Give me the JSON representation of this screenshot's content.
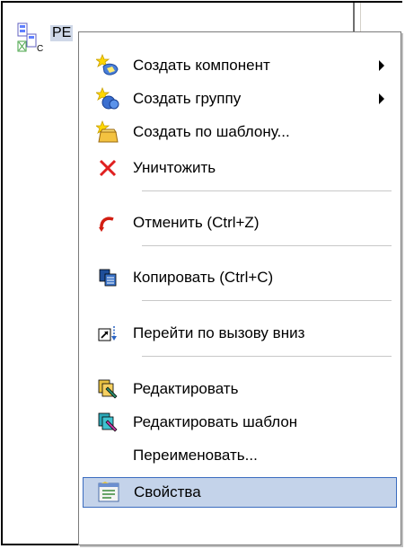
{
  "tree": {
    "node_label": "PE"
  },
  "menu": {
    "items": [
      {
        "label": "Создать компонент",
        "icon": "star-component-icon",
        "submenu": true
      },
      {
        "label": "Создать группу",
        "icon": "star-group-icon",
        "submenu": true
      },
      {
        "label": "Создать по шаблону...",
        "icon": "star-template-icon",
        "submenu": false
      },
      {
        "label": "Уничтожить",
        "icon": "red-x-delete-icon",
        "submenu": false
      },
      {
        "label": "Отменить (Ctrl+Z)",
        "icon": "undo-arrow-icon",
        "submenu": false
      },
      {
        "label": "Копировать (Ctrl+C)",
        "icon": "copy-icon",
        "submenu": false
      },
      {
        "label": "Перейти по вызову вниз",
        "icon": "goto-call-down-icon",
        "submenu": false
      },
      {
        "label": "Редактировать",
        "icon": "edit-icon",
        "submenu": false
      },
      {
        "label": "Редактировать шаблон",
        "icon": "edit-template-icon",
        "submenu": false
      },
      {
        "label": "Переименовать...",
        "icon": "",
        "submenu": false
      },
      {
        "label": "Свойства",
        "icon": "properties-icon",
        "submenu": false,
        "highlighted": true
      }
    ]
  },
  "colors": {
    "highlight_bg": "#c4d3ea",
    "highlight_border": "#3a6cbf",
    "delete_red": "#e02020",
    "undo_red": "#d21e12"
  }
}
